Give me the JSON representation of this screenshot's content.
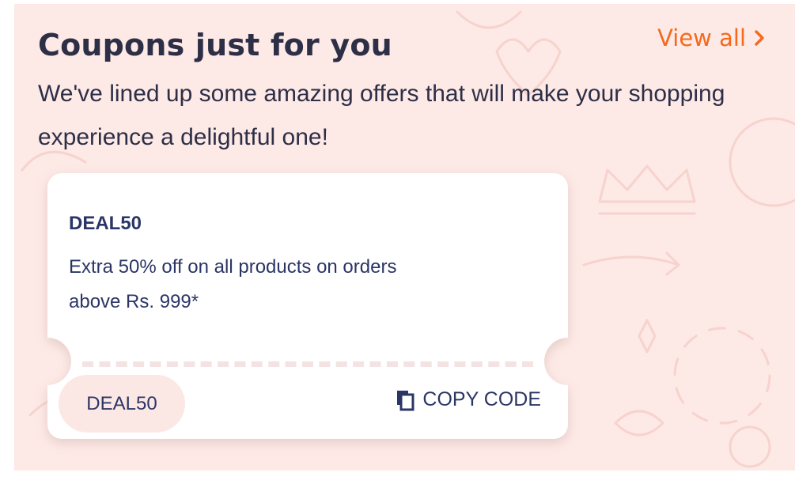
{
  "section": {
    "title": "Coupons just for you",
    "view_all_label": "View all",
    "subtitle": "We've lined up some amazing offers that will make your shopping experience a delightful one!",
    "colors": {
      "panel_bg": "#fde9e6",
      "accent": "#f46a1c",
      "text": "#2d2f47"
    }
  },
  "coupons": [
    {
      "code_title": "DEAL50",
      "description": "Extra 50% off on all products on orders above Rs. 999*",
      "code": "DEAL50",
      "copy_label": "COPY CODE",
      "copy_icon": "copy-icon"
    }
  ]
}
